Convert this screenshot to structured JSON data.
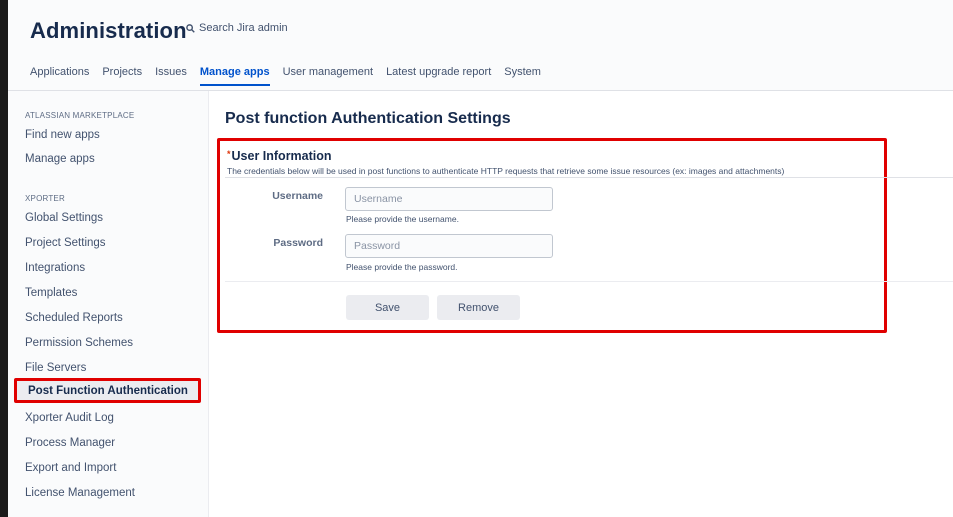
{
  "header": {
    "title": "Administration",
    "search_placeholder": "Search Jira admin"
  },
  "nav": {
    "tabs": [
      {
        "label": "Applications"
      },
      {
        "label": "Projects"
      },
      {
        "label": "Issues"
      },
      {
        "label": "Manage apps",
        "active": true
      },
      {
        "label": "User management"
      },
      {
        "label": "Latest upgrade report"
      },
      {
        "label": "System"
      }
    ]
  },
  "sidebar": {
    "sections": [
      {
        "heading": "ATLASSIAN MARKETPLACE",
        "items": [
          "Find new apps",
          "Manage apps"
        ]
      },
      {
        "heading": "XPORTER",
        "items": [
          "Global Settings",
          "Project Settings",
          "Integrations",
          "Templates",
          "Scheduled Reports",
          "Permission Schemes",
          "File Servers",
          "Post Function Authentication",
          "Xporter Audit Log",
          "Process Manager",
          "Export and Import",
          "License Management"
        ]
      }
    ],
    "active_item": "Post Function Authentication"
  },
  "main": {
    "title": "Post function Authentication Settings",
    "section": {
      "required_marker": "*",
      "title": "User Information",
      "description": "The credentials below will be used in post functions to authenticate HTTP requests that retrieve some issue resources (ex: images and attachments)"
    },
    "fields": {
      "username": {
        "label": "Username",
        "placeholder": "Username",
        "help": "Please provide the username."
      },
      "password": {
        "label": "Password",
        "placeholder": "Password",
        "help": "Please provide the password."
      }
    },
    "buttons": {
      "save": "Save",
      "remove": "Remove"
    }
  },
  "colors": {
    "highlight": "#e00000",
    "accent": "#0052cc"
  }
}
